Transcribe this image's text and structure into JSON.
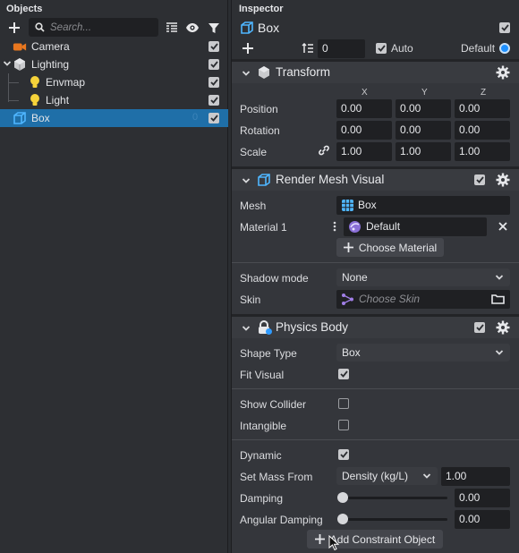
{
  "objects_panel": {
    "title": "Objects",
    "search_placeholder": "Search...",
    "tree": [
      {
        "label": "Camera",
        "icon": "camera-icon",
        "checked": true
      },
      {
        "label": "Lighting",
        "icon": "lighting-group-icon",
        "checked": true,
        "expanded": true
      },
      {
        "label": "Envmap",
        "icon": "bulb-icon",
        "checked": true
      },
      {
        "label": "Light",
        "icon": "bulb-icon",
        "checked": true
      },
      {
        "label": "Box",
        "icon": "box-icon",
        "checked": true,
        "selected": true,
        "count": "0"
      }
    ]
  },
  "inspector": {
    "title": "Inspector",
    "object_name": "Box",
    "layer_value": "0",
    "auto_label": "Auto",
    "default_label": "Default",
    "accent_color": "#1e90ff",
    "transform": {
      "title": "Transform",
      "columns": [
        "X",
        "Y",
        "Z"
      ],
      "rows": [
        {
          "label": "Position",
          "values": [
            "0.00",
            "0.00",
            "0.00"
          ]
        },
        {
          "label": "Rotation",
          "values": [
            "0.00",
            "0.00",
            "0.00"
          ]
        },
        {
          "label": "Scale",
          "values": [
            "1.00",
            "1.00",
            "1.00"
          ]
        }
      ]
    },
    "render_mesh": {
      "title": "Render Mesh Visual",
      "mesh_label": "Mesh",
      "mesh_value": "Box",
      "material_label": "Material 1",
      "material_value": "Default",
      "choose_material_label": "Choose Material",
      "shadow_label": "Shadow mode",
      "shadow_value": "None",
      "skin_label": "Skin",
      "skin_placeholder": "Choose Skin"
    },
    "physics": {
      "title": "Physics Body",
      "shape_type_label": "Shape Type",
      "shape_type_value": "Box",
      "fit_visual_label": "Fit Visual",
      "show_collider_label": "Show Collider",
      "intangible_label": "Intangible",
      "dynamic_label": "Dynamic",
      "set_mass_label": "Set Mass From",
      "set_mass_mode": "Density (kg/L)",
      "set_mass_value": "1.00",
      "damping_label": "Damping",
      "damping_value": "0.00",
      "angular_damping_label": "Angular Damping",
      "angular_damping_value": "0.00",
      "add_constraint_label": "Add Constraint Object"
    }
  }
}
